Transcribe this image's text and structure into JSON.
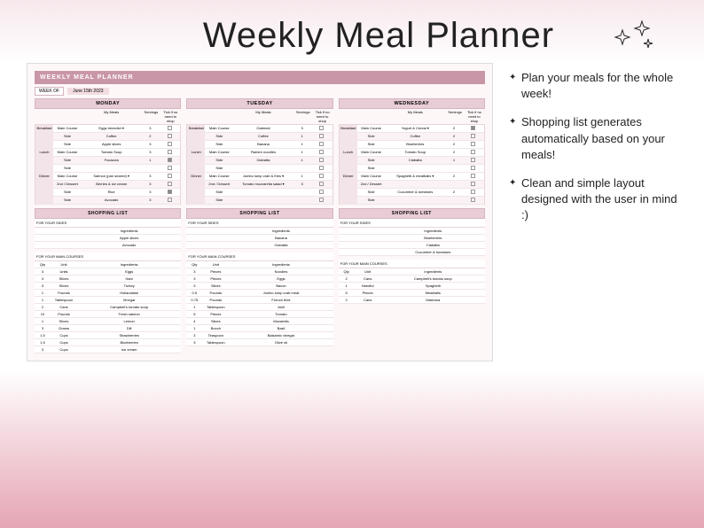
{
  "title": "Weekly Meal Planner",
  "bullets": [
    "Plan your meals for the whole week!",
    "Shopping list generates automatically based on your meals!",
    "Clean and simple layout designed with the user in mind :)"
  ],
  "planner": {
    "header": "WEEKLY MEAL PLANNER",
    "week_of_label": "WEEK OF",
    "week_of_value": "June 15th 2023",
    "column_headers": {
      "meals": "My Meals",
      "servings": "Servings",
      "tick": "Tick if no need to shop"
    },
    "course_labels": {
      "main": "Main Course",
      "side": "Side",
      "dessert": "2nd / Dessert"
    },
    "meal_groups": [
      "Breakfast",
      "Lunch",
      "Dinner"
    ],
    "shopping_header": "SHOPPING LIST",
    "shop_sides_label": "FOR YOUR SIDES",
    "shop_mains_label": "FOR YOUR MAIN COURSES",
    "shop_cols": {
      "qty": "Qty",
      "unit": "Unit",
      "ing": "Ingredients"
    },
    "days": [
      {
        "name": "MONDAY",
        "meals": [
          {
            "group": "Breakfast",
            "rows": [
              {
                "course": "main",
                "meal": "Eggs benedict ▾",
                "serv": "3",
                "tick": false
              },
              {
                "course": "side",
                "meal": "Coffee",
                "serv": "2",
                "tick": false
              },
              {
                "course": "side",
                "meal": "Apple slices",
                "serv": "3",
                "tick": false
              }
            ]
          },
          {
            "group": "Lunch",
            "rows": [
              {
                "course": "main",
                "meal": "Tomato Soup",
                "serv": "3",
                "tick": false
              },
              {
                "course": "side",
                "meal": "Focaccia",
                "serv": "1",
                "tick": true
              },
              {
                "course": "side",
                "meal": "",
                "serv": "",
                "tick": false
              }
            ]
          },
          {
            "group": "Dinner",
            "rows": [
              {
                "course": "main",
                "meal": "Salmon (pan seared) ▾",
                "serv": "3",
                "tick": false
              },
              {
                "course": "dessert",
                "meal": "Berries & ice cream",
                "serv": "3",
                "tick": false
              },
              {
                "course": "side",
                "meal": "Rice",
                "serv": "3",
                "tick": true
              },
              {
                "course": "side",
                "meal": "Avocado",
                "serv": "3",
                "tick": false
              }
            ]
          }
        ],
        "sides": [
          {
            "ing": "Apple slices"
          },
          {
            "ing": "Avocado"
          }
        ],
        "mains": [
          {
            "qty": "3",
            "unit": "Units",
            "ing": "Eggs"
          },
          {
            "qty": "3",
            "unit": "Slices",
            "ing": "Ham"
          },
          {
            "qty": "3",
            "unit": "Slices",
            "ing": "Turkey"
          },
          {
            "qty": "1",
            "unit": "Pounds",
            "ing": "Hollandaise"
          },
          {
            "qty": "1",
            "unit": "Tablespoon",
            "ing": "Vinegar"
          },
          {
            "qty": "2",
            "unit": "Cans",
            "ing": "Campbell's tomato soup"
          },
          {
            "qty": "10",
            "unit": "Pounds",
            "ing": "Fresh salmon"
          },
          {
            "qty": "1",
            "unit": "Slices",
            "ing": "Lemon"
          },
          {
            "qty": "3",
            "unit": "Grams",
            "ing": "Dill"
          },
          {
            "qty": "1.5",
            "unit": "Cups",
            "ing": "Strawberries"
          },
          {
            "qty": "1.5",
            "unit": "Cups",
            "ing": "Blueberries"
          },
          {
            "qty": "3",
            "unit": "Cups",
            "ing": "Ice cream"
          }
        ]
      },
      {
        "name": "TUESDAY",
        "meals": [
          {
            "group": "Breakfast",
            "rows": [
              {
                "course": "main",
                "meal": "Oatmeal",
                "serv": "3",
                "tick": false
              },
              {
                "course": "side",
                "meal": "Coffee",
                "serv": "1",
                "tick": false
              },
              {
                "course": "side",
                "meal": "Banana",
                "serv": "1",
                "tick": false
              }
            ]
          },
          {
            "group": "Lunch",
            "rows": [
              {
                "course": "main",
                "meal": "Ramen noodles",
                "serv": "1",
                "tick": false
              },
              {
                "course": "side",
                "meal": "Ciabatta",
                "serv": "1",
                "tick": false
              },
              {
                "course": "side",
                "meal": "",
                "serv": "",
                "tick": false
              }
            ]
          },
          {
            "group": "Dinner",
            "rows": [
              {
                "course": "main",
                "meal": "Jumbo lump crab & fries ▾",
                "serv": "1",
                "tick": false
              },
              {
                "course": "dessert",
                "meal": "Tomato mozzarella salad ▾",
                "serv": "3",
                "tick": false
              },
              {
                "course": "side",
                "meal": "",
                "serv": "",
                "tick": false
              },
              {
                "course": "side",
                "meal": "",
                "serv": "",
                "tick": false
              }
            ]
          }
        ],
        "sides": [
          {
            "ing": "Banana"
          },
          {
            "ing": "Ciabatta"
          }
        ],
        "mains": [
          {
            "qty": "3",
            "unit": "Pieces",
            "ing": "Noodles"
          },
          {
            "qty": "3",
            "unit": "Pieces",
            "ing": "Eggs"
          },
          {
            "qty": "3",
            "unit": "Slices",
            "ing": "Bacon"
          },
          {
            "qty": "0.5",
            "unit": "Pounds",
            "ing": "Jumbo lump crab meat"
          },
          {
            "qty": "0.75",
            "unit": "Pounds",
            "ing": "French fries"
          },
          {
            "qty": "1",
            "unit": "Tablespoon",
            "ing": "Aioli"
          },
          {
            "qty": "5",
            "unit": "Pieces",
            "ing": "Tomato"
          },
          {
            "qty": "4",
            "unit": "Slices",
            "ing": "Mozarella"
          },
          {
            "qty": "1",
            "unit": "Bunch",
            "ing": "Basil"
          },
          {
            "qty": "3",
            "unit": "Teaspoon",
            "ing": "Balsamic vinegar"
          },
          {
            "qty": "3",
            "unit": "Tablespoon",
            "ing": "Olive oil"
          }
        ]
      },
      {
        "name": "WEDNESDAY",
        "meals": [
          {
            "group": "Breakfast",
            "rows": [
              {
                "course": "main",
                "meal": "Yogurt & Cereal ▾",
                "serv": "2",
                "tick": true
              },
              {
                "course": "side",
                "meal": "Coffee",
                "serv": "2",
                "tick": false
              },
              {
                "course": "side",
                "meal": "Blueberries",
                "serv": "2",
                "tick": false
              }
            ]
          },
          {
            "group": "Lunch",
            "rows": [
              {
                "course": "main",
                "meal": "Tomato Soup",
                "serv": "2",
                "tick": false
              },
              {
                "course": "side",
                "meal": "Ciabatta",
                "serv": "1",
                "tick": false
              },
              {
                "course": "side",
                "meal": "",
                "serv": "",
                "tick": false
              }
            ]
          },
          {
            "group": "Dinner",
            "rows": [
              {
                "course": "main",
                "meal": "Spaghetti & meatballs ▾",
                "serv": "2",
                "tick": false
              },
              {
                "course": "dessert",
                "meal": "",
                "serv": "",
                "tick": false
              },
              {
                "course": "side",
                "meal": "Cucumber & tomatoes",
                "serv": "2",
                "tick": false
              },
              {
                "course": "side",
                "meal": "",
                "serv": "",
                "tick": false
              }
            ]
          }
        ],
        "sides": [
          {
            "ing": "Blueberries"
          },
          {
            "ing": "Ciabatta"
          },
          {
            "ing": "Cucumber & tomatoes"
          }
        ],
        "mains": [
          {
            "qty": "2",
            "unit": "Cans",
            "ing": "Campbell's tomato soup"
          },
          {
            "qty": "1",
            "unit": "Handful",
            "ing": "Spaghetti"
          },
          {
            "qty": "5",
            "unit": "Pieces",
            "ing": "Meatballs"
          },
          {
            "qty": "2",
            "unit": "Cans",
            "ing": "Marinara"
          }
        ]
      }
    ]
  }
}
